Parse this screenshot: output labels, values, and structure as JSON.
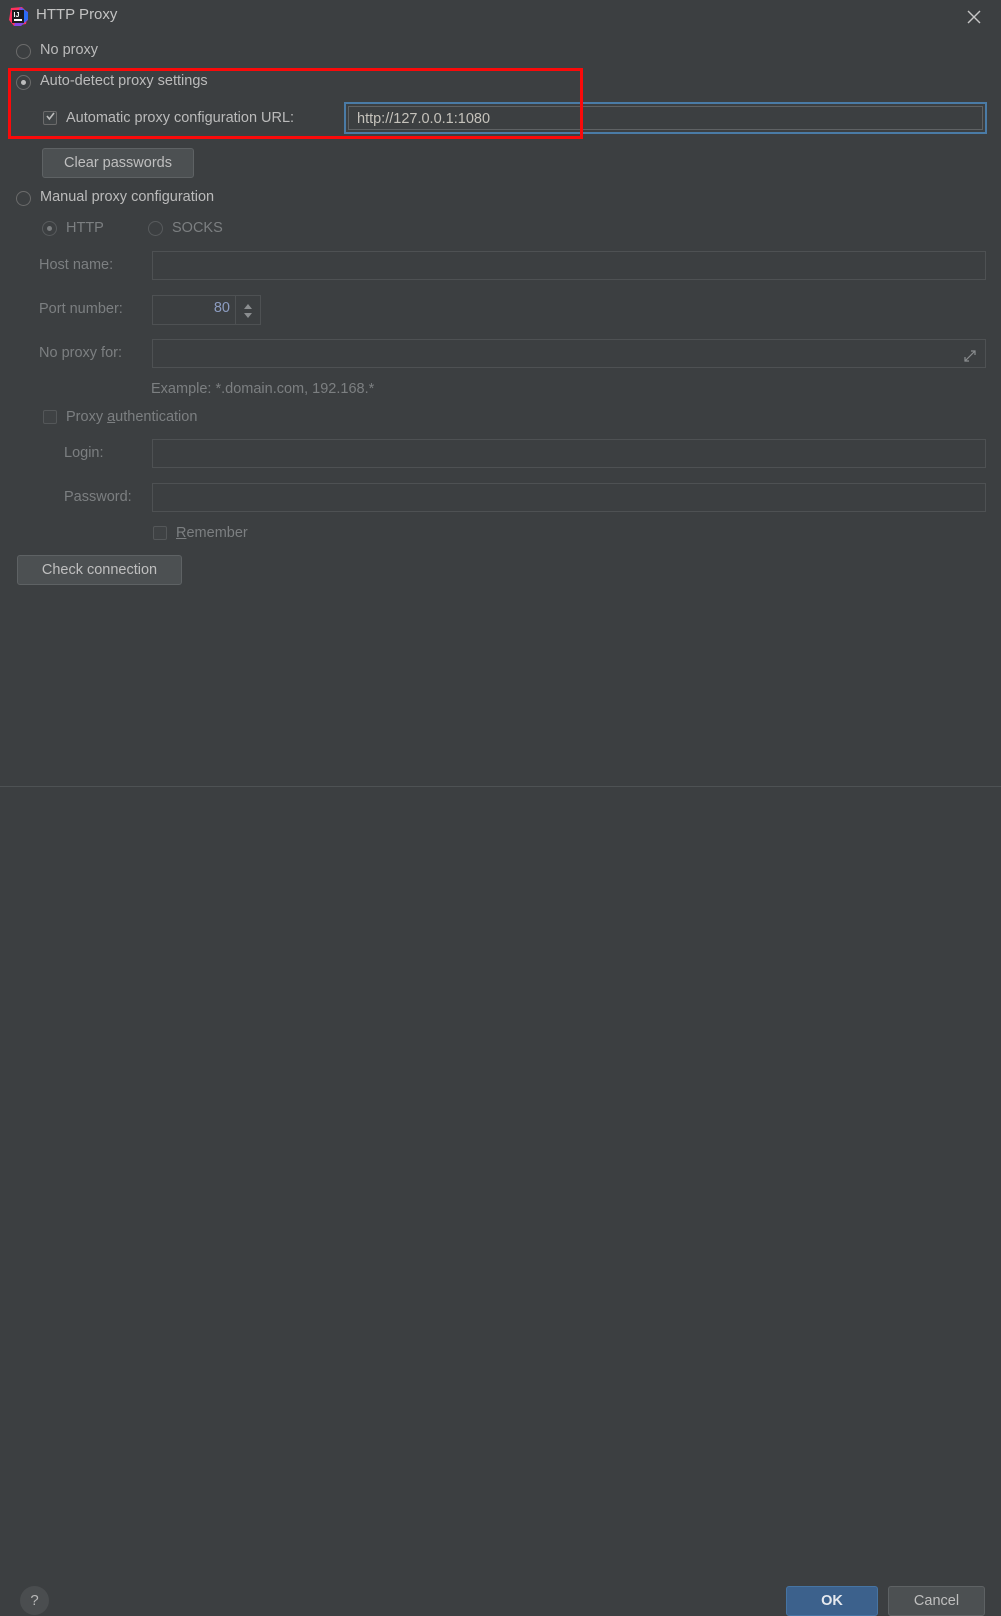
{
  "window": {
    "title": "HTTP Proxy",
    "app_icon": "intellij-idea-icon",
    "close_icon": "close-icon"
  },
  "options": {
    "no_proxy": {
      "label": "No proxy",
      "selected": false
    },
    "auto_detect": {
      "label": "Auto-detect proxy settings",
      "selected": true
    },
    "auto_config_url": {
      "label": "Automatic proxy configuration URL:",
      "checked": true,
      "value": "http://127.0.0.1:1080"
    },
    "clear_passwords": {
      "label": "Clear passwords"
    },
    "manual": {
      "label": "Manual proxy configuration",
      "selected": false
    },
    "protocol": {
      "http_label": "HTTP",
      "http_selected": true,
      "socks_label": "SOCKS",
      "socks_selected": false
    },
    "host_name": {
      "label": "Host name:",
      "value": ""
    },
    "port_number": {
      "label": "Port number:",
      "value": "80"
    },
    "no_proxy_for": {
      "label": "No proxy for:",
      "value": "",
      "expand_icon": "expand-icon"
    },
    "example_hint": "Example: *.domain.com, 192.168.*",
    "proxy_auth": {
      "label_pre": "Proxy ",
      "label_mnemonic": "a",
      "label_post": "uthentication",
      "checked": false
    },
    "login": {
      "label": "Login:",
      "value": ""
    },
    "password": {
      "label": "Password:",
      "value": ""
    },
    "remember": {
      "label_mnemonic": "R",
      "label_post": "emember",
      "checked": false
    },
    "check_connection": {
      "label": "Check connection"
    }
  },
  "footer": {
    "help_label": "?",
    "ok_label": "OK",
    "cancel_label": "Cancel"
  },
  "colors": {
    "background": "#3c3f41",
    "highlight": "#fa0a0a",
    "focus_border": "#4a7ba6",
    "ok_button": "#3c618c",
    "text": "#bbbbbb",
    "text_disabled": "#7c7f81",
    "spinner_value": "#8c9cc0"
  }
}
